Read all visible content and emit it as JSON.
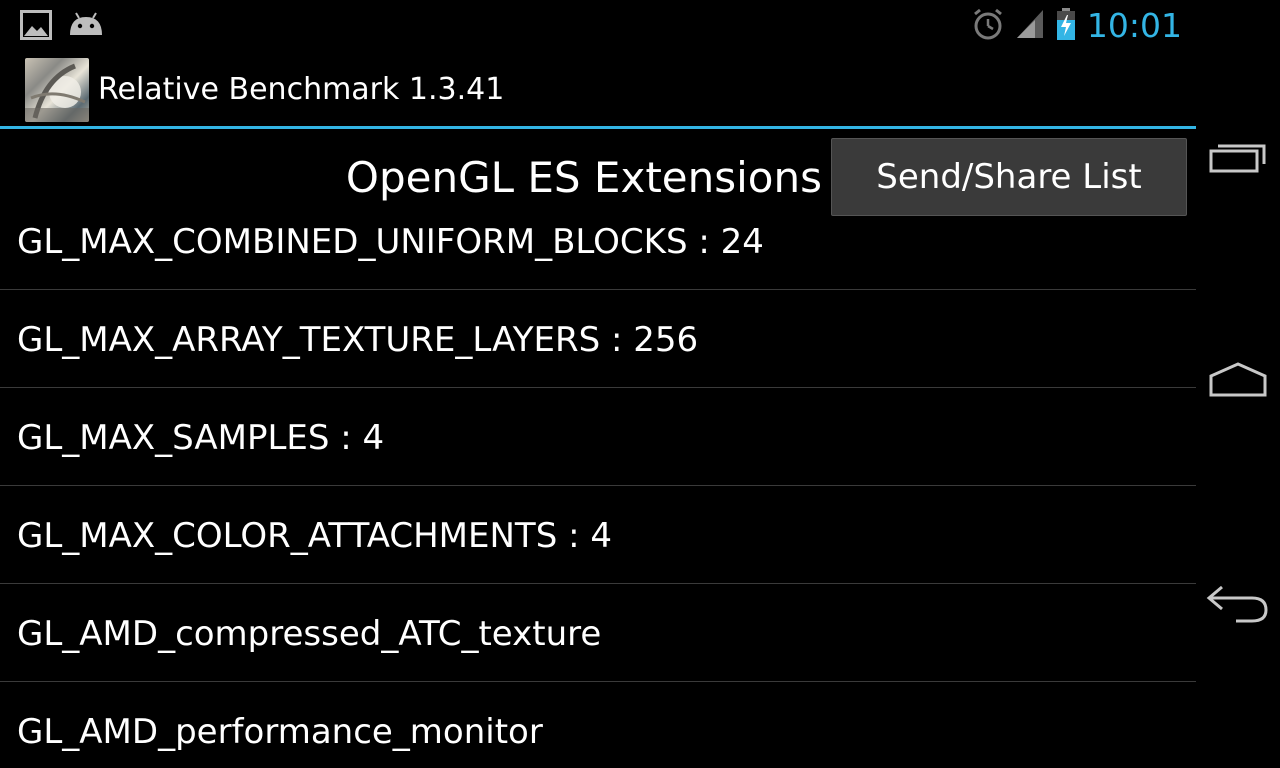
{
  "status_bar": {
    "time": "10:01",
    "notification_icons": [
      "gallery-icon",
      "android-icon"
    ],
    "system_icons": [
      "alarm-icon",
      "signal-icon",
      "battery-charging-icon"
    ],
    "accent_color": "#33b5e5"
  },
  "action_bar": {
    "title": "Relative Benchmark 1.3.41"
  },
  "main": {
    "section_title": "OpenGL ES Extensions",
    "share_button_label": "Send/Share List",
    "extensions": [
      "GL_MAX_COMBINED_UNIFORM_BLOCKS : 24",
      "GL_MAX_ARRAY_TEXTURE_LAYERS : 256",
      "GL_MAX_SAMPLES : 4",
      "GL_MAX_COLOR_ATTACHMENTS : 4",
      "GL_AMD_compressed_ATC_texture",
      "GL_AMD_performance_monitor"
    ]
  },
  "nav_bar": {
    "buttons": [
      "recent-apps-icon",
      "home-icon",
      "back-icon"
    ]
  }
}
